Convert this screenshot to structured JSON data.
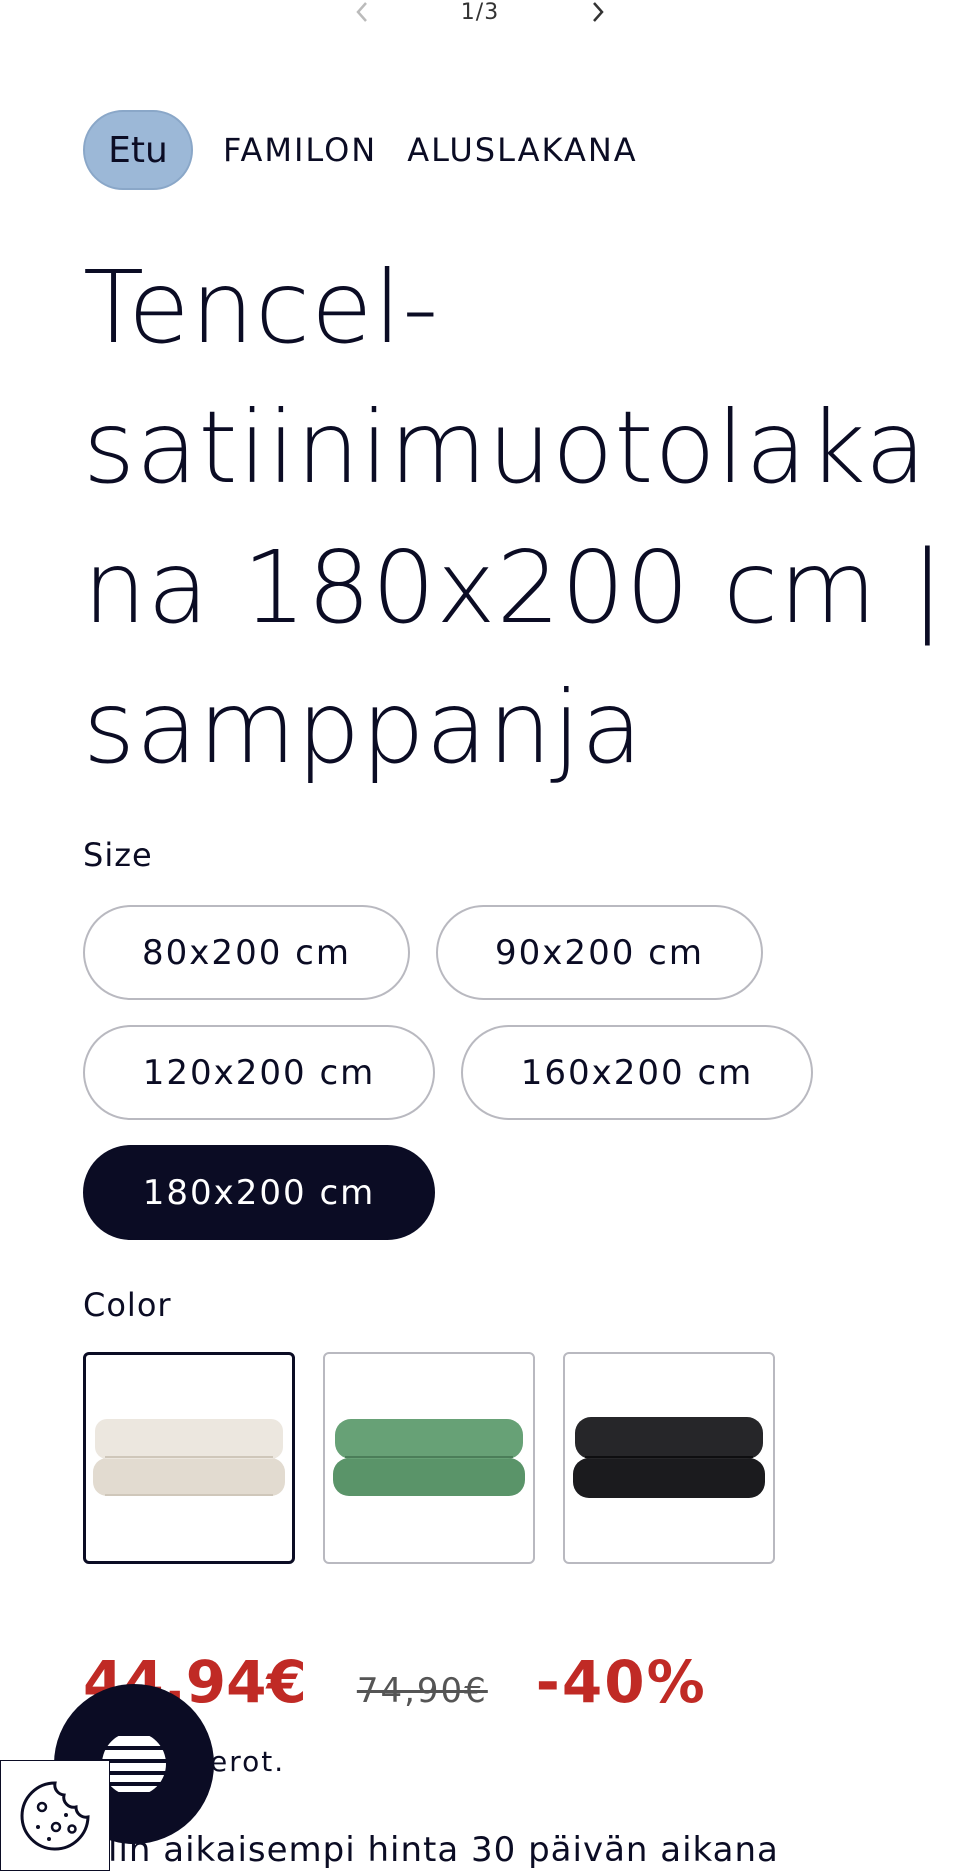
{
  "gallery": {
    "counter": "1/3"
  },
  "breadcrumb": {
    "home": "Etu",
    "items": [
      "FAMILON",
      "ALUSLAKANA"
    ]
  },
  "product": {
    "title_lines": [
      "Tencel-",
      "satiinimuotolaka",
      "na 180x200 cm |",
      "samppanja"
    ]
  },
  "size": {
    "label": "Size",
    "options": [
      "80x200 cm",
      "90x200 cm",
      "120x200 cm",
      "160x200 cm",
      "180x200 cm"
    ],
    "selected": "180x200 cm"
  },
  "color": {
    "label": "Color",
    "options": [
      {
        "name": "champagne",
        "hex": "#e6e0d6",
        "selected": true
      },
      {
        "name": "green",
        "hex": "#5e9a6e",
        "selected": false
      },
      {
        "name": "black",
        "hex": "#1f1f22",
        "selected": false
      }
    ]
  },
  "price": {
    "sale": "44,94€",
    "original": "74,90€",
    "discount": "-40%"
  },
  "tax_note": "erot.",
  "previous_price_text": "lin aikaisempi hinta 30 päivän aikana",
  "colors": {
    "ink": "#0b0c24",
    "sale_red": "#c02a25",
    "pill_blue": "#9cb8d7"
  }
}
